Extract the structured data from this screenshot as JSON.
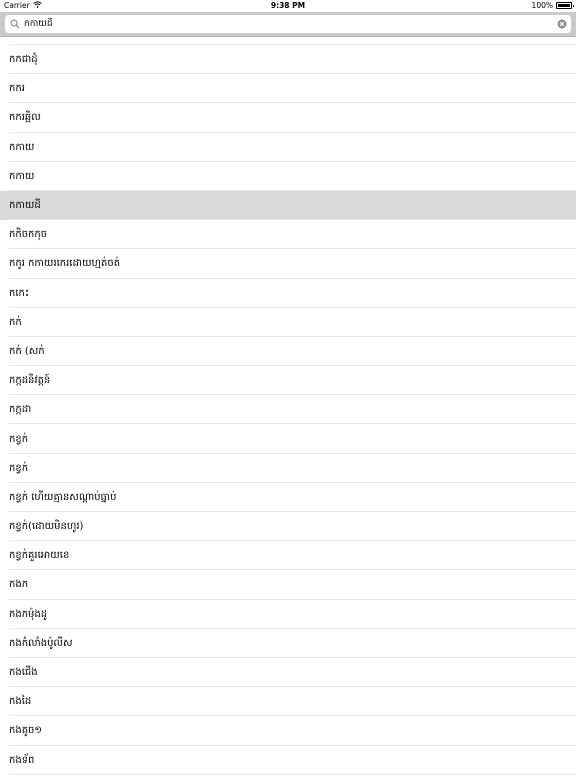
{
  "status_bar": {
    "carrier": "Carrier",
    "time": "9:38 PM",
    "battery": "100%"
  },
  "search": {
    "value": "កកាយដី"
  },
  "list": {
    "items": [
      "",
      "កកជាដុំ",
      "កករ",
      "កករឆ្អិល",
      "កកាយ",
      "កកាយ",
      "កកាយដី",
      "កកិចកកុច",
      "កកូរ កកាយរកេរដោយហ្មត់ចត់",
      "កកេះ",
      "កក់",
      "កក់ (សក់",
      "កក្កដនិវត្តន៍",
      "កក្កដា",
      "កខ្វក់",
      "កខ្វក់",
      "កខ្វក់ ហើយគ្មានសណ្ដាប់ធ្នាប់",
      "កខ្វក់(ដោយមិនហូរ)",
      "កខ្វក់គួរអោយខេ",
      "កងក",
      "កងកម៉ុងដូ",
      "កងកំលាំងប៉ូលីស",
      "កងជើង",
      "កងដៃ",
      "កងតូច១",
      "កងទ័ព"
    ],
    "selected_index": 6
  }
}
